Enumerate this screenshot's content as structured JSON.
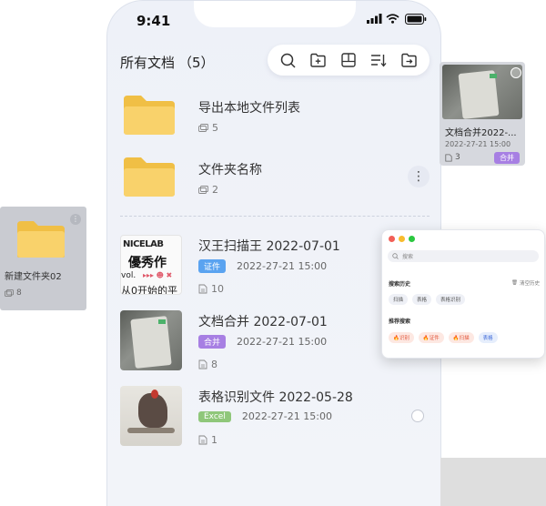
{
  "status": {
    "time": "9:41"
  },
  "header": {
    "title": "所有文档",
    "count": "（5）"
  },
  "toolbar": {
    "icons": [
      "search-icon",
      "add-folder-icon",
      "layout-icon",
      "sort-icon",
      "move-folder-icon"
    ]
  },
  "folders": [
    {
      "name": "导出本地文件列表",
      "count": "5"
    },
    {
      "name": "文件夹名称",
      "count": "2"
    }
  ],
  "files": [
    {
      "name": "汉王扫描王 2022-07-01",
      "tag": "证件",
      "tag_color": "#5aa3f0",
      "date": "2022-27-21 15:00",
      "pages": "10",
      "thumb_text": [
        "NICELAB",
        "優秀作",
        "vol.",
        "从0开始的平"
      ]
    },
    {
      "name": "文档合并 2022-07-01",
      "tag": "合并",
      "tag_color": "#a77fe3",
      "date": "2022-27-21 15:00",
      "pages": "8"
    },
    {
      "name": "表格识别文件 2022-05-28",
      "tag": "Excel",
      "tag_color": "#8fc77a",
      "date": "2022-27-21 15:00",
      "pages": "1"
    }
  ],
  "left_card": {
    "name": "新建文件夹02",
    "count": "8"
  },
  "right_card": {
    "name": "文档合并2022-...",
    "date": "2022-27-21 15:00",
    "pages": "3",
    "tag": "合并"
  },
  "search_window": {
    "placeholder": "搜索",
    "history_title": "搜索历史",
    "clear_label": "清空历史",
    "history": [
      "扫描",
      "表格",
      "表格识别"
    ],
    "recommend_title": "推荐搜索",
    "recommend": [
      {
        "label": "识别",
        "hot": true
      },
      {
        "label": "证件",
        "hot": true
      },
      {
        "label": "扫描",
        "hot": true
      },
      {
        "label": "表格",
        "hot": false
      }
    ]
  },
  "colors": {
    "folder": "#f9d26b",
    "folder_dark": "#f0bf45",
    "accent_purple": "#a77fe3"
  }
}
